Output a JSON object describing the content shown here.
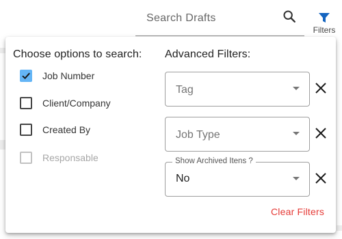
{
  "search": {
    "placeholder": "Search Drafts",
    "icon": "search-icon"
  },
  "filters_button": {
    "label": "Filters",
    "icon": "filter-icon",
    "color": "#1565c0"
  },
  "panel": {
    "left_heading": "Choose options to search:",
    "right_heading": "Advanced Filters:",
    "options": [
      {
        "label": "Job Number",
        "checked": true,
        "disabled": false
      },
      {
        "label": "Client/Company",
        "checked": false,
        "disabled": false
      },
      {
        "label": "Created By",
        "checked": false,
        "disabled": false
      },
      {
        "label": "Responsable",
        "checked": false,
        "disabled": true
      }
    ],
    "filters": {
      "tag": {
        "placeholder": "Tag"
      },
      "job_type": {
        "placeholder": "Job Type"
      },
      "archived": {
        "label": "Show Archived Itens ?",
        "value": "No"
      }
    },
    "clear_filters": "Clear Filters"
  },
  "colors": {
    "accent": "#64b5f6",
    "danger": "#e53935"
  }
}
